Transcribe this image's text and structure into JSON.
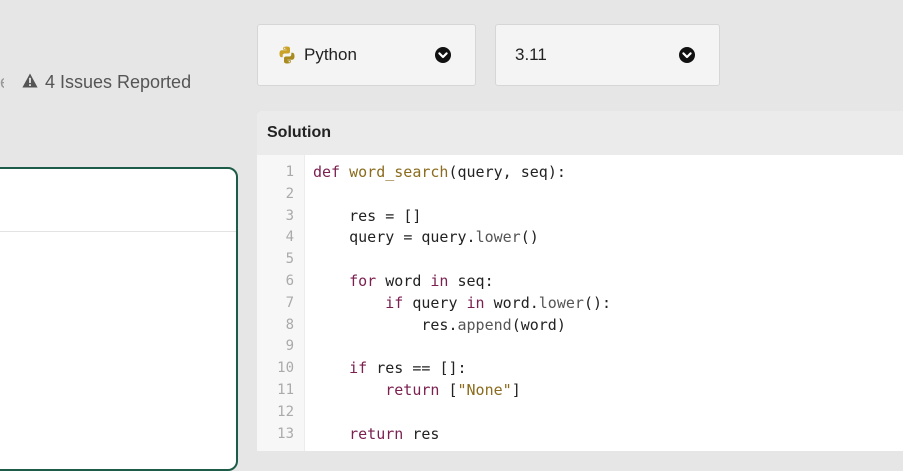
{
  "issues": {
    "label": "4 Issues Reported",
    "cut_char": "e"
  },
  "language_select": {
    "value": "Python"
  },
  "version_select": {
    "value": "3.11"
  },
  "solution": {
    "title": "Solution",
    "line_numbers": [
      "1",
      "2",
      "3",
      "4",
      "5",
      "6",
      "7",
      "8",
      "9",
      "10",
      "11",
      "12",
      "13"
    ],
    "code_lines": [
      "def word_search(query, seq):",
      "",
      "    res = []",
      "    query = query.lower()",
      "",
      "    for word in seq:",
      "        if query in word.lower():",
      "            res.append(word)",
      "",
      "    if res == []:",
      "        return [\"None\"]",
      "",
      "    return res"
    ]
  },
  "colors": {
    "accent_border": "#1d5c48",
    "python_icon": "#c9a227",
    "keyword": "#7a1f4f",
    "function": "#8b6b1d"
  },
  "icons": [
    "warning-icon",
    "python-icon",
    "chevron-down-icon"
  ]
}
